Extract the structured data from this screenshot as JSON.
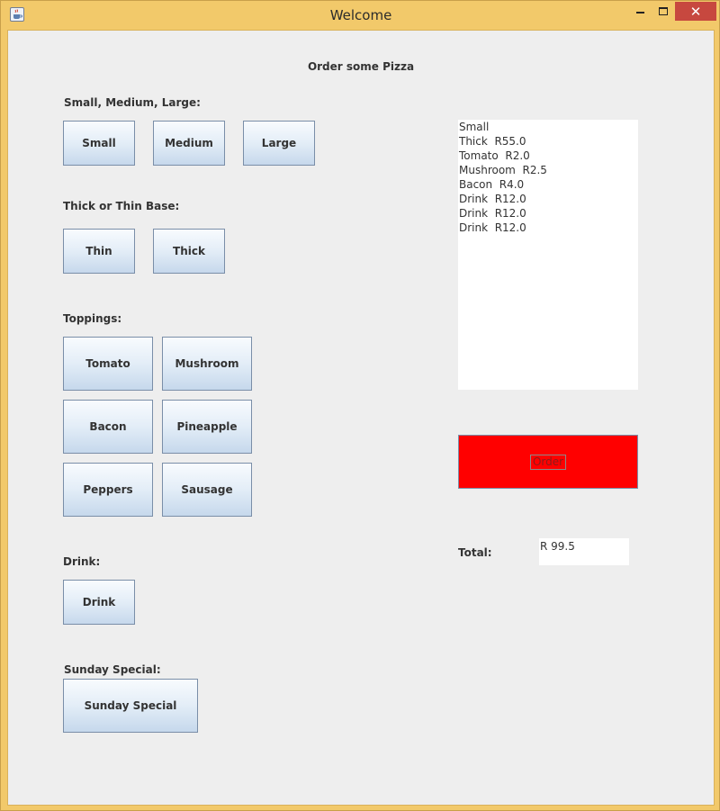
{
  "window": {
    "title": "Welcome",
    "close_glyph": "✕"
  },
  "header": {
    "title": "Order some Pizza"
  },
  "size": {
    "label": "Small, Medium, Large:",
    "buttons": [
      "Small",
      "Medium",
      "Large"
    ]
  },
  "base": {
    "label": "Thick or Thin Base:",
    "buttons": [
      "Thin",
      "Thick"
    ]
  },
  "toppings": {
    "label": "Toppings:",
    "buttons": [
      "Tomato",
      "Mushroom",
      "Bacon",
      "Pineapple",
      "Peppers",
      "Sausage"
    ]
  },
  "drink": {
    "label": "Drink:",
    "button": "Drink"
  },
  "special": {
    "label": "Sunday Special:",
    "button": "Sunday Special"
  },
  "order_list": {
    "items": [
      "Small",
      "Thick  R55.0",
      "Tomato  R2.0",
      "Mushroom  R2.5",
      "Bacon  R4.0",
      "Drink  R12.0",
      "Drink  R12.0",
      "Drink  R12.0"
    ]
  },
  "order_button": {
    "label": "Order",
    "color": "#ff0000"
  },
  "total": {
    "label": "Total:",
    "value": "R 99.5"
  }
}
